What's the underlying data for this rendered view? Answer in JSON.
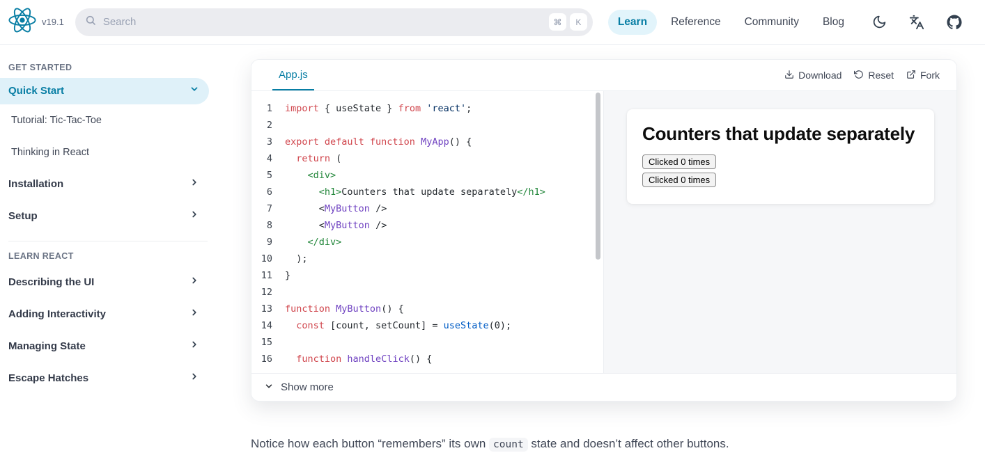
{
  "nav": {
    "version": "v19.1",
    "search": {
      "placeholder": "Search",
      "keys": [
        "cmd",
        "K"
      ]
    },
    "links": [
      {
        "label": "Learn",
        "active": true
      },
      {
        "label": "Reference",
        "active": false
      },
      {
        "label": "Community",
        "active": false
      },
      {
        "label": "Blog",
        "active": false
      }
    ],
    "icon_buttons": [
      "dark-mode-icon",
      "translate-icon",
      "github-icon"
    ]
  },
  "sidebar": {
    "sections": [
      {
        "label": "GET STARTED",
        "items": [
          {
            "label": "Quick Start",
            "state": "active",
            "chevron": "down"
          },
          {
            "label": "Tutorial: Tic-Tac-Toe",
            "type": "sub"
          },
          {
            "label": "Thinking in React",
            "type": "sub"
          },
          {
            "label": "Installation",
            "chevron": "right"
          },
          {
            "label": "Setup",
            "chevron": "right"
          }
        ]
      },
      {
        "label": "LEARN REACT",
        "divider_before": true,
        "items": [
          {
            "label": "Describing the UI",
            "chevron": "right"
          },
          {
            "label": "Adding Interactivity",
            "chevron": "right"
          },
          {
            "label": "Managing State",
            "chevron": "right"
          },
          {
            "label": "Escape Hatches",
            "chevron": "right"
          }
        ]
      }
    ]
  },
  "sandbox": {
    "tab": "App.js",
    "actions": [
      {
        "icon": "download-icon",
        "label": "Download"
      },
      {
        "icon": "reset-icon",
        "label": "Reset"
      },
      {
        "icon": "fork-icon",
        "label": "Fork"
      }
    ],
    "code_lines": [
      {
        "n": "1",
        "t": [
          [
            "k",
            "import "
          ],
          [
            "p",
            "{ useState } "
          ],
          [
            "k",
            "from "
          ],
          [
            "s",
            "'react'"
          ],
          [
            "p",
            ";"
          ]
        ]
      },
      {
        "n": "2",
        "t": []
      },
      {
        "n": "3",
        "t": [
          [
            "k",
            "export default function "
          ],
          [
            "d",
            "MyApp"
          ],
          [
            "p",
            "() {"
          ]
        ]
      },
      {
        "n": "4",
        "t": [
          [
            "p",
            "  "
          ],
          [
            "k",
            "return"
          ],
          [
            "p",
            " ("
          ]
        ]
      },
      {
        "n": "5",
        "t": [
          [
            "p",
            "    "
          ],
          [
            "t",
            "<div>"
          ]
        ]
      },
      {
        "n": "6",
        "t": [
          [
            "p",
            "      "
          ],
          [
            "t",
            "<h1>"
          ],
          [
            "p",
            "Counters that update separately"
          ],
          [
            "t",
            "</h1>"
          ]
        ]
      },
      {
        "n": "7",
        "t": [
          [
            "p",
            "      <"
          ],
          [
            "d",
            "MyButton"
          ],
          [
            "p",
            " />"
          ]
        ]
      },
      {
        "n": "8",
        "t": [
          [
            "p",
            "      <"
          ],
          [
            "d",
            "MyButton"
          ],
          [
            "p",
            " />"
          ]
        ]
      },
      {
        "n": "9",
        "t": [
          [
            "p",
            "    "
          ],
          [
            "t",
            "</div>"
          ]
        ]
      },
      {
        "n": "10",
        "t": [
          [
            "p",
            "  );"
          ]
        ]
      },
      {
        "n": "11",
        "t": [
          [
            "p",
            "}"
          ]
        ]
      },
      {
        "n": "12",
        "t": []
      },
      {
        "n": "13",
        "t": [
          [
            "k",
            "function "
          ],
          [
            "d",
            "MyButton"
          ],
          [
            "p",
            "() {"
          ]
        ]
      },
      {
        "n": "14",
        "t": [
          [
            "p",
            "  "
          ],
          [
            "k",
            "const"
          ],
          [
            "p",
            " [count, setCount] = "
          ],
          [
            "f",
            "useState"
          ],
          [
            "p",
            "(0);"
          ]
        ]
      },
      {
        "n": "15",
        "t": []
      },
      {
        "n": "16",
        "t": [
          [
            "p",
            "  "
          ],
          [
            "k",
            "function "
          ],
          [
            "d",
            "handleClick"
          ],
          [
            "p",
            "() {"
          ]
        ]
      }
    ],
    "preview": {
      "title": "Counters that update separately",
      "buttons": [
        "Clicked 0 times",
        "Clicked 0 times"
      ]
    },
    "show_more_label": "Show more"
  },
  "article": {
    "before": "Notice how each button “remembers” its own ",
    "inline_code": "count",
    "after": " state and doesn’t affect other buttons."
  },
  "colors": {
    "accent": "#087ea4",
    "active_pill_bg": "#dff1f9",
    "nav_pill_bg": "#e2f4fb",
    "preview_bg": "#f6f7f9",
    "syntax": {
      "keyword": "#d0454c",
      "definition": "#6f42c1",
      "tag": "#22863a",
      "string": "#032f62",
      "function_call": "#005cc5",
      "plain": "#24292e"
    }
  }
}
